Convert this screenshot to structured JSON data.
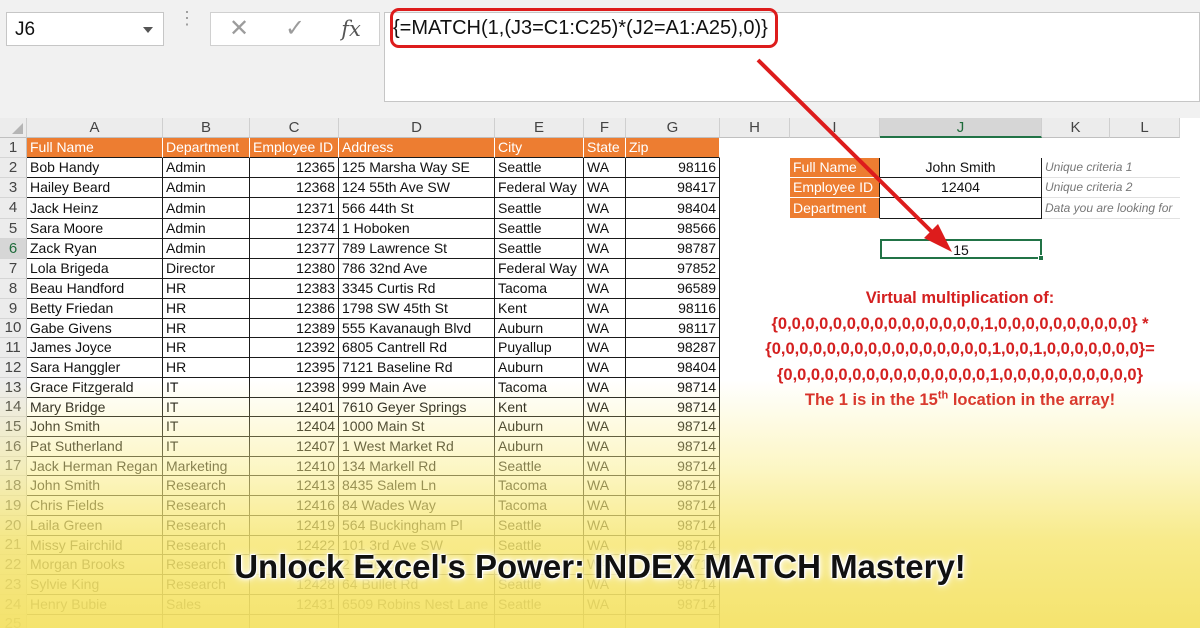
{
  "namebox": {
    "cell": "J6"
  },
  "formula_bar": {
    "formula": "{=MATCH(1,(J3=C1:C25)*(J2=A1:A25),0)}"
  },
  "toolbar": {
    "cancel_glyph": "✕",
    "enter_glyph": "✓",
    "fx_label": "fx",
    "dots": "⋮"
  },
  "columns": [
    "A",
    "B",
    "C",
    "D",
    "E",
    "F",
    "G",
    "H",
    "I",
    "J",
    "K",
    "L"
  ],
  "rows": [
    "1",
    "2",
    "3",
    "4",
    "5",
    "6",
    "7",
    "8",
    "9",
    "10",
    "11",
    "12",
    "13",
    "14",
    "15",
    "16",
    "17",
    "18",
    "19",
    "20",
    "21",
    "22",
    "23",
    "24",
    "25"
  ],
  "table": {
    "headers": [
      "Full Name",
      "Department",
      "Employee ID",
      "Address",
      "City",
      "State",
      "Zip"
    ],
    "rows": [
      [
        "Bob Handy",
        "Admin",
        "12365",
        "125 Marsha Way SE",
        "Seattle",
        "WA",
        "98116"
      ],
      [
        "Hailey Beard",
        "Admin",
        "12368",
        "124 55th Ave SW",
        "Federal Way",
        "WA",
        "98417"
      ],
      [
        "Jack Heinz",
        "Admin",
        "12371",
        "566 44th St",
        "Seattle",
        "WA",
        "98404"
      ],
      [
        "Sara Moore",
        "Admin",
        "12374",
        "1 Hoboken",
        "Seattle",
        "WA",
        "98566"
      ],
      [
        "Zack Ryan",
        "Admin",
        "12377",
        "789 Lawrence St",
        "Seattle",
        "WA",
        "98787"
      ],
      [
        "Lola Brigeda",
        "Director",
        "12380",
        "786 32nd Ave",
        "Federal Way",
        "WA",
        "97852"
      ],
      [
        "Beau Handford",
        "HR",
        "12383",
        "3345 Curtis Rd",
        "Tacoma",
        "WA",
        "96589"
      ],
      [
        "Betty Friedan",
        "HR",
        "12386",
        "1798 SW 45th St",
        "Kent",
        "WA",
        "98116"
      ],
      [
        "Gabe Givens",
        "HR",
        "12389",
        "555 Kavanaugh Blvd",
        "Auburn",
        "WA",
        "98117"
      ],
      [
        "James Joyce",
        "HR",
        "12392",
        "6805 Cantrell Rd",
        "Puyallup",
        "WA",
        "98287"
      ],
      [
        "Sara Hanggler",
        "HR",
        "12395",
        "7121 Baseline Rd",
        "Auburn",
        "WA",
        "98404"
      ],
      [
        "Grace Fitzgerald",
        "IT",
        "12398",
        "999 Main Ave",
        "Tacoma",
        "WA",
        "98714"
      ],
      [
        "Mary Bridge",
        "IT",
        "12401",
        "7610 Geyer Springs",
        "Kent",
        "WA",
        "98714"
      ],
      [
        "John Smith",
        "IT",
        "12404",
        "1000 Main St",
        "Auburn",
        "WA",
        "98714"
      ],
      [
        "Pat Sutherland",
        "IT",
        "12407",
        "1 West Market Rd",
        "Auburn",
        "WA",
        "98714"
      ],
      [
        "Jack Herman Regan",
        "Marketing",
        "12410",
        "134 Markell Rd",
        "Seattle",
        "WA",
        "98714"
      ],
      [
        "John Smith",
        "Research",
        "12413",
        "8435 Salem Ln",
        "Tacoma",
        "WA",
        "98714"
      ],
      [
        "Chris Fields",
        "Research",
        "12416",
        "84 Wades Way",
        "Tacoma",
        "WA",
        "98714"
      ],
      [
        "Laila Green",
        "Research",
        "12419",
        "564 Buckingham Pl",
        "Seattle",
        "WA",
        "98714"
      ],
      [
        "Missy Fairchild",
        "Research",
        "12422",
        "101 3rd Ave SW",
        "Seattle",
        "WA",
        "98714"
      ],
      [
        "Morgan Brooks",
        "Research",
        "12425",
        "2 Pine St",
        "Seattle",
        "WA",
        "98714"
      ],
      [
        "Sylvie King",
        "Research",
        "12428",
        "64 Bullet Rd",
        "Seattle",
        "WA",
        "98714"
      ],
      [
        "Henry Bubie",
        "Sales",
        "12431",
        "6509 Robins Nest Lane",
        "Seattle",
        "WA",
        "98714"
      ],
      [
        "",
        "",
        "",
        "",
        "",
        "",
        ""
      ]
    ]
  },
  "lookup": {
    "labels": [
      "Full Name",
      "Employee ID",
      "Department"
    ],
    "values": [
      "John Smith",
      "12404",
      ""
    ],
    "notes": [
      "Unique criteria 1",
      "Unique criteria 2",
      "Data you are looking for"
    ],
    "result": "15"
  },
  "annotation": {
    "line1": "Virtual multiplication of:",
    "line2": "{0,0,0,0,0,0,0,0,0,0,0,0,0,0,0,1,0,0,0,0,0,0,0,0,0,0} *",
    "line3": "{0,0,0,0,0,0,0,0,0,0,0,0,0,0,0,0,1,0,0,1,0,0,0,0,0,0,0}=",
    "line4": "{0,0,0,0,0,0,0,0,0,0,0,0,0,0,0,1,0,0,0,0,0,0,0,0,0,0}",
    "line5_pre": "The 1 is in the 15",
    "line5_sup": "th",
    "line5_post": " location in the array!"
  },
  "banner": {
    "title": "Unlock Excel's Power: INDEX MATCH Mastery!"
  },
  "colors": {
    "header_orange": "#ed7d31",
    "annotation_red": "#d42020",
    "excel_green": "#217346"
  }
}
